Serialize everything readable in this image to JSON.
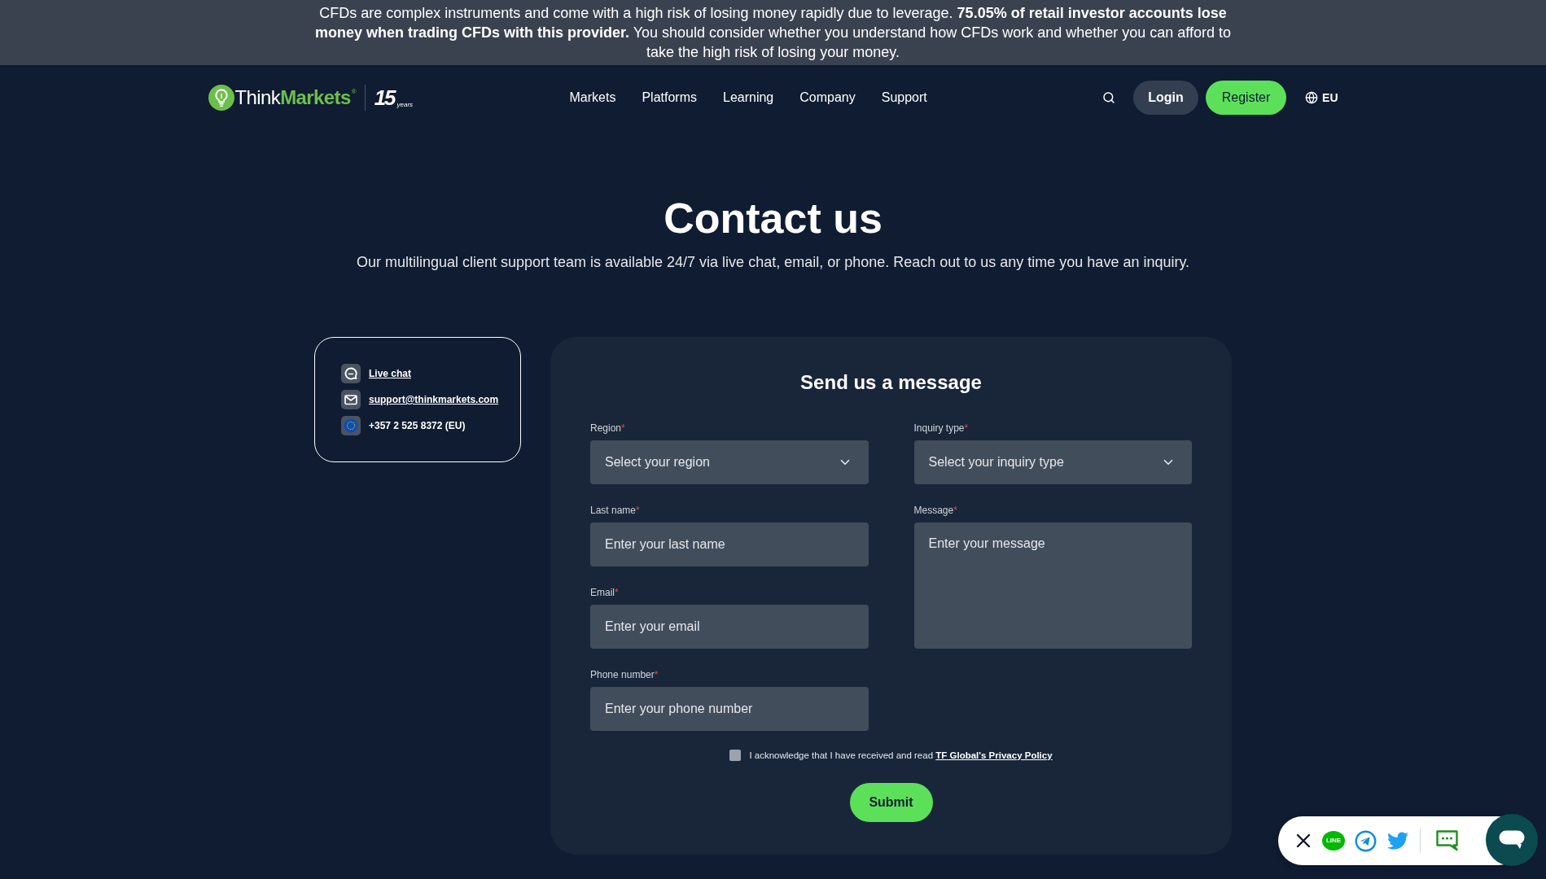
{
  "risk_warning": {
    "text": "CFDs are complex instruments and come with a high risk of losing money rapidly due to leverage. **75.05% of retail investor accounts lose money when trading CFDs with this provider.** You should consider whether you understand how CFDs work and whether you can afford to take the high risk of losing your money."
  },
  "header": {
    "logo": {
      "word_1": "Think",
      "word_2": "Markets",
      "registered_mark": "®",
      "anniversary_number": "15",
      "anniversary_caption": "years"
    },
    "nav": [
      "Markets",
      "Platforms",
      "Learning",
      "Company",
      "Support"
    ],
    "login": "Login",
    "register": "Register",
    "region": "EU"
  },
  "hero": {
    "title": "Contact us",
    "subtitle": "Our multilingual client support team is available 24/7 via live chat, email, or phone. Reach out to us any time you have an inquiry."
  },
  "contact_card": {
    "items": [
      {
        "kind": "chat",
        "text": "Live chat",
        "link": true
      },
      {
        "kind": "email",
        "text": "support@thinkmarkets.com",
        "link": true
      },
      {
        "kind": "phone",
        "text": "+357 2 525 8372 (EU)",
        "link": false
      }
    ]
  },
  "form": {
    "title": "Send us a message",
    "columns": [
      {
        "fields": [
          {
            "kind": "select",
            "label": "Region",
            "required": true,
            "required_mark": "*",
            "placeholder": "Select your region"
          },
          {
            "kind": "input",
            "label": "Last name",
            "required": true,
            "required_mark": "*",
            "placeholder": "Enter your last name"
          },
          {
            "kind": "input",
            "label": "Email",
            "required": true,
            "required_mark": "*",
            "placeholder": "Enter your email"
          },
          {
            "kind": "input",
            "label": "Phone number",
            "required": true,
            "required_mark": "*",
            "placeholder": "Enter your phone number"
          }
        ]
      },
      {
        "fields": [
          {
            "kind": "select",
            "label": "Inquiry type",
            "required": true,
            "required_mark": "*",
            "placeholder": "Select your inquiry type"
          },
          {
            "kind": "textarea",
            "label": "Message",
            "required": true,
            "required_mark": "*",
            "placeholder": "Enter your message"
          }
        ]
      }
    ],
    "consent": {
      "checked": false,
      "text": "I acknowledge that I have received and read",
      "link": "TF Global's Privacy Policy"
    },
    "submit": "Submit"
  },
  "chat_widget": {
    "line_label": "LINE"
  }
}
